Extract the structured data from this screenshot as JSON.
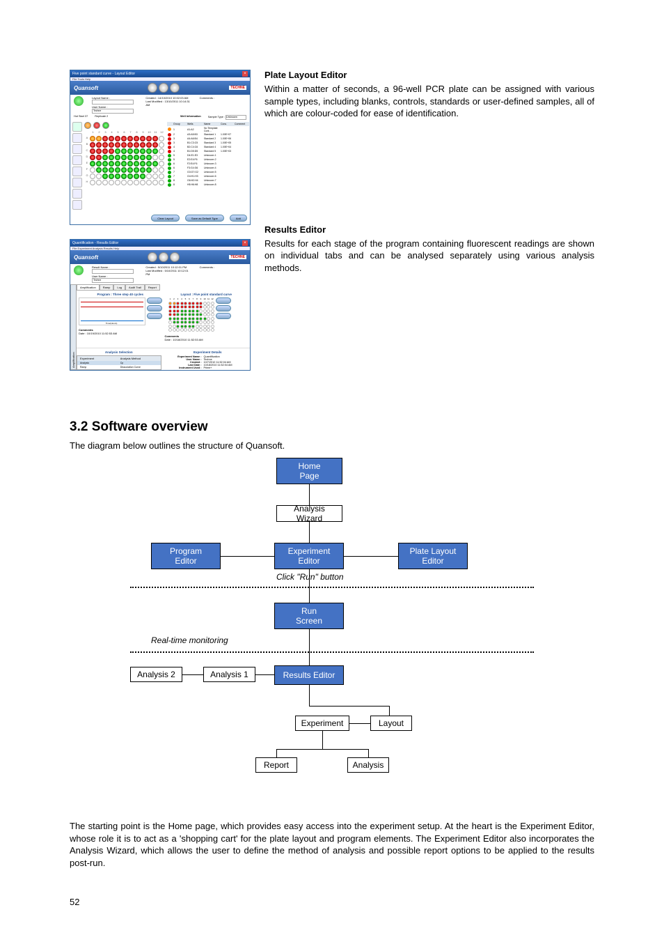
{
  "screenshot1": {
    "window_title": "Five point standard curve - Layout Editor",
    "menu": "File  Tools  Help",
    "brand": "Quansoft",
    "techne": "TECHNE",
    "layout_name_label": "Layout Name :",
    "user_name_label": "User Name :",
    "user_name_value": "Techne",
    "created_label": "Created :",
    "created_value": "14/10/2010 10:02:03 AM",
    "modified_label": "Last Modified :",
    "modified_value": "13/10/2011 10:14:31 AM",
    "comments_label": "Comments :",
    "hot_start_label": "Hot Start",
    "replicate_label": "Replicate",
    "replicate_value": "2",
    "well_info_label": "Well Information",
    "sampletype_label": "Sample Type :",
    "sampletype_value": "Unknown",
    "cols": [
      "1",
      "2",
      "3",
      "4",
      "5",
      "6",
      "7",
      "8",
      "9",
      "10",
      "11",
      "12"
    ],
    "rows": [
      "A",
      "B",
      "C",
      "D",
      "E",
      "F",
      "G",
      "H"
    ],
    "table_headers": [
      "",
      "Group",
      "Wells",
      "Name",
      "Conc.",
      "Comment"
    ],
    "table_rows": [
      {
        "c": "orange",
        "group": "1",
        "wells": "A1:A2",
        "name": "No Template Cont…",
        "conc": ""
      },
      {
        "c": "red",
        "group": "2",
        "wells": "A3:A5:B3",
        "name": "Standard 1",
        "conc": "1.00E+07"
      },
      {
        "c": "red",
        "group": "3",
        "wells": "A4:A6:B4",
        "name": "Standard 2",
        "conc": "1.00E+06"
      },
      {
        "c": "red",
        "group": "3",
        "wells": "B1:C3:C5",
        "name": "Standard 3",
        "conc": "1.00E+05"
      },
      {
        "c": "red",
        "group": "4",
        "wells": "B2:C4:C6",
        "name": "Standard 4",
        "conc": "1.00E+04"
      },
      {
        "c": "red",
        "group": "4",
        "wells": "B1:D5:D5",
        "name": "Standard 5",
        "conc": "1.00E+03"
      },
      {
        "c": "green",
        "group": "5",
        "wells": "D4:E1:E3",
        "name": "Unknown 1",
        "conc": ""
      },
      {
        "c": "green",
        "group": "5",
        "wells": "E2:E4:F6",
        "name": "Unknown 2",
        "conc": ""
      },
      {
        "c": "green",
        "group": "6",
        "wells": "F2:E4:F6",
        "name": "Unknown 3",
        "conc": ""
      },
      {
        "c": "green",
        "group": "6",
        "wells": "F3:G4:G6",
        "name": "Unknown 4",
        "conc": ""
      },
      {
        "c": "green",
        "group": "7",
        "wells": "G3:G7:G2",
        "name": "Unknown 5",
        "conc": ""
      },
      {
        "c": "green",
        "group": "7",
        "wells": "G4:H1:H3",
        "name": "Unknown 6",
        "conc": ""
      },
      {
        "c": "green",
        "group": "8",
        "wells": "G6:H2:H4",
        "name": "Unknown 7",
        "conc": ""
      },
      {
        "c": "green",
        "group": "8",
        "wells": "H5:H6:H8",
        "name": "Unknown 8",
        "conc": ""
      }
    ],
    "btn_clear": "Clear Layout",
    "btn_save": "Save as Default Type",
    "btn_add": "Add"
  },
  "screenshot2": {
    "window_title": "Quantification - Results Editor",
    "menu": "File  Experiment  Analysis  Results  Help",
    "brand": "Quansoft",
    "techne": "TECHNE",
    "result_name_label": "Result Name :",
    "user_name_label": "User Name :",
    "user_name_value": "Techne",
    "created_label": "Created :",
    "created_value": "5/10/2011 10:12:01 PM",
    "modified_label": "Last Modified :",
    "modified_value": "5/10/2011 10:12:01 PM",
    "comments_label": "Comments :",
    "tabs": [
      "Amplification",
      "Ramp",
      "Log",
      "Audit Trail",
      "Report"
    ],
    "sidetab": "Amplification",
    "prog_title": "Program : Three step 40 cycles",
    "xaxis": "Time(Hours)",
    "layout_title": "Layout : Five point standard curve",
    "comments_title": "Comments",
    "date_label": "Date :",
    "date_value": "10/19/2010 11:52:53 AM",
    "rcomments_title": "Comments",
    "rdate_label": "Date :",
    "rdate_value": "10/18/2010 11:52:53 AM",
    "analysis_title": "Analysis Selection",
    "col_exp": "Experiment",
    "col_method": "Analysis Method",
    "row1a": "Analysis",
    "row1b": "Cp",
    "row2a": "Ramp",
    "row2b": "Dissociation Curve",
    "exp_title": "Experiment Details",
    "exp_name_l": "Experiment Name :",
    "exp_name_v": "Quantification",
    "exp_user_l": "User Name :",
    "exp_user_v": "Techne",
    "exp_created_l": "Created :",
    "exp_created_v": "10/7/2010 11:52:04 AM",
    "exp_last_l": "Last Date :",
    "exp_last_v": "10/18/2010 11:52:04 AM",
    "exp_instr_l": "Instrument Used :",
    "exp_instr_v": "Prime+"
  },
  "descriptions": {
    "ple_title": "Plate Layout Editor",
    "ple_body": "Within a matter of seconds, a 96-well PCR plate can be assigned with various sample types, including blanks, controls, standards or user-defined samples, all of which are colour-coded for ease of identification.",
    "re_title": "Results Editor",
    "re_body": "Results for each stage of the program containing fluorescent readings are shown on individual tabs and can be analysed separately using various analysis methods."
  },
  "section": {
    "heading": "3.2  Software overview",
    "sub": "The diagram below outlines the structure of Quansoft.",
    "home": "Home\nPage",
    "wizard": "Analysis Wizard",
    "program": "Program\nEditor",
    "experiment": "Experiment\nEditor",
    "plate": "Plate Layout\nEditor",
    "click_run": "Click \"Run\" button",
    "run": "Run\nScreen",
    "realtime": "Real-time monitoring",
    "results": "Results Editor",
    "a1": "Analysis 1",
    "a2": "Analysis 2",
    "exp": "Experiment",
    "layout": "Layout",
    "report": "Report",
    "analysis": "Analysis",
    "bottom": "The starting point is the Home page, which provides easy access into the experiment setup. At the heart is the Experiment Editor, whose role it is to act as a 'shopping cart' for the plate layout and program elements. The Experiment Editor also incorporates the Analysis Wizard, which allows the user to define the method of analysis and possible report options to be applied to the results post-run."
  },
  "page_number": "52"
}
